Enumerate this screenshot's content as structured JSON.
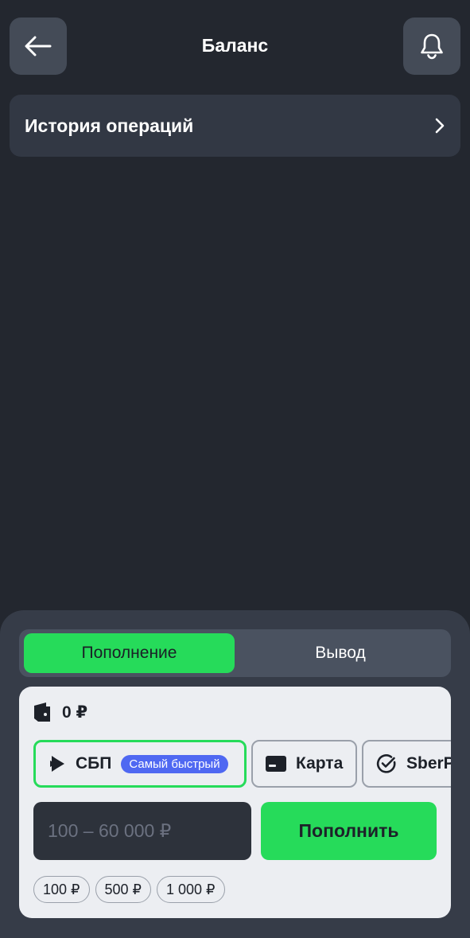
{
  "header": {
    "title": "Баланс",
    "back_icon": "arrow-left-icon",
    "bell_icon": "bell-icon"
  },
  "history": {
    "label": "История операций",
    "icon": "chevron-right-icon"
  },
  "tabs": [
    {
      "label": "Пополнение",
      "active": true
    },
    {
      "label": "Вывод",
      "active": false
    }
  ],
  "balance": {
    "icon": "wallet-icon",
    "value": "0 ₽"
  },
  "methods": [
    {
      "label": "СБП",
      "badge": "Самый быстрый",
      "icon": "sbp-icon",
      "selected": true
    },
    {
      "label": "Карта",
      "icon": "card-icon",
      "selected": false
    },
    {
      "label": "SberPay",
      "icon": "check-circle-icon",
      "selected": false
    }
  ],
  "amount": {
    "placeholder": "100 – 60 000 ₽",
    "value": ""
  },
  "topup_button": "Пополнить",
  "chips": [
    "100 ₽",
    "500 ₽",
    "1 000 ₽"
  ],
  "colors": {
    "accent": "#26db5a",
    "badge": "#4f68f2",
    "background": "#23272f"
  }
}
